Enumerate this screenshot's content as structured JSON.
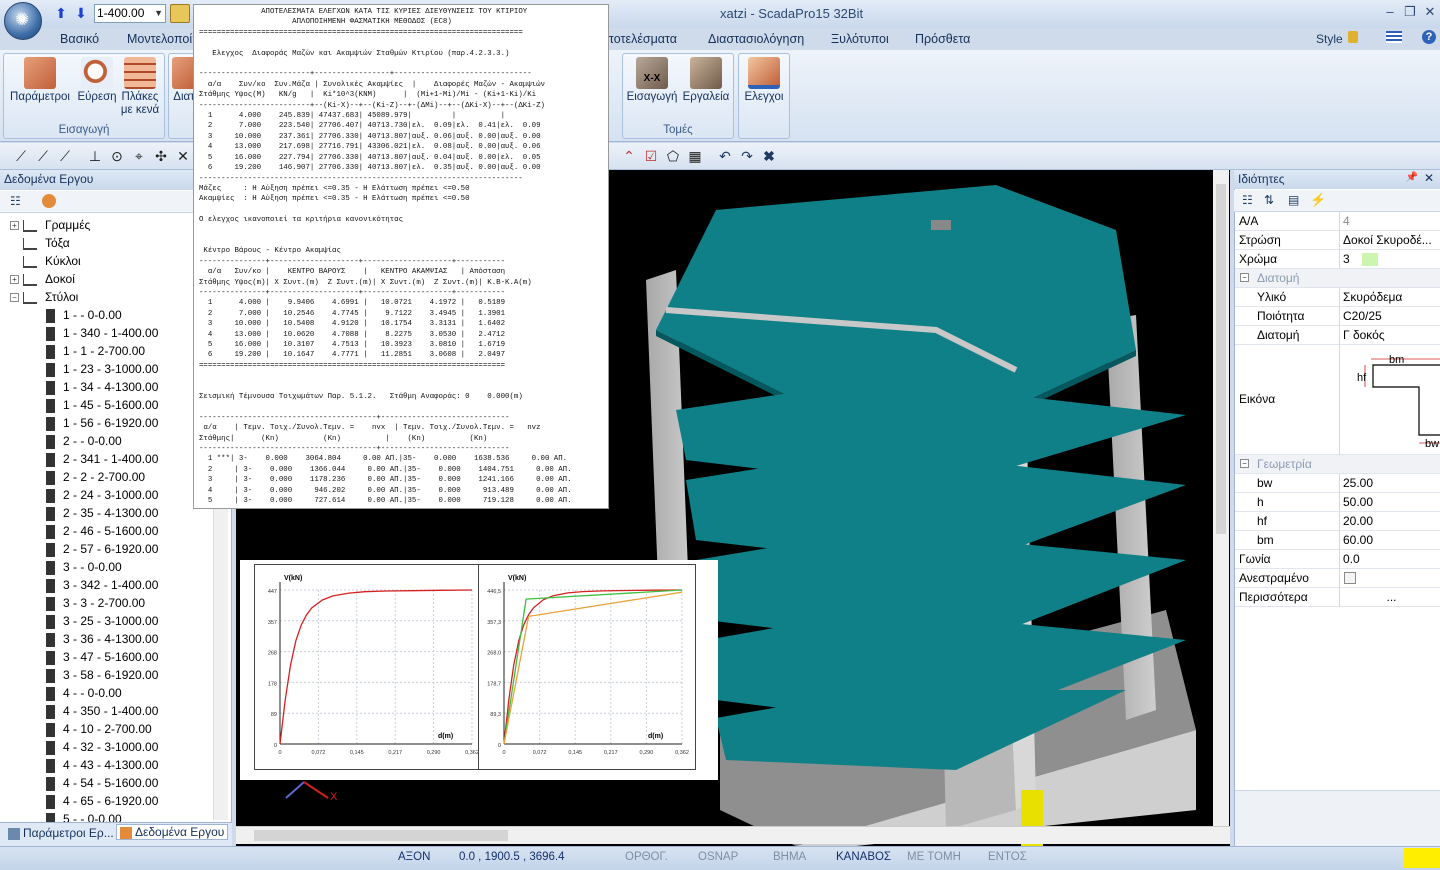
{
  "quick": {
    "level_value": "1-400.00"
  },
  "window": {
    "title": "xatzi - ScadaPro15 32Bit",
    "style_label": "Style",
    "help": "?"
  },
  "tabs": [
    "Βασικό",
    "Μοντελοποίη",
    "Αποτελέσματα",
    "Διαστασιολόγηση",
    "Ξυλότυποι",
    "Πρόσθετα"
  ],
  "ribbon": {
    "insert_group": {
      "label": "Εισαγωγή",
      "buttons": [
        "Παράμετροι",
        "Εύρεση",
        "Πλάκες\nμε κενά"
      ],
      "cut_label": "Διατ"
    },
    "sections_group": {
      "label": "Τομές",
      "buttons": [
        "Εισαγωγή",
        "Εργαλεία"
      ]
    },
    "checks_button": "Ελεγχοι",
    "xx_text": "X-X"
  },
  "left_panel": {
    "title": "Δεδομένα Εργου",
    "tree": [
      {
        "label": "Γραμμές",
        "level": 0,
        "exp": "+"
      },
      {
        "label": "Τόξα",
        "level": 0,
        "exp": ""
      },
      {
        "label": "Κύκλοι",
        "level": 0,
        "exp": ""
      },
      {
        "label": "Δοκοί",
        "level": 0,
        "exp": "+"
      },
      {
        "label": "Στύλοι",
        "level": 0,
        "exp": "−"
      },
      {
        "label": "1 -   - 0-0.00",
        "level": 1
      },
      {
        "label": "1 - 340 - 1-400.00",
        "level": 1
      },
      {
        "label": "1 - 1 - 2-700.00",
        "level": 1
      },
      {
        "label": "1 - 23 - 3-1000.00",
        "level": 1
      },
      {
        "label": "1 - 34 - 4-1300.00",
        "level": 1
      },
      {
        "label": "1 - 45 - 5-1600.00",
        "level": 1
      },
      {
        "label": "1 - 56 - 6-1920.00",
        "level": 1
      },
      {
        "label": "2 -   - 0-0.00",
        "level": 1
      },
      {
        "label": "2 - 341 - 1-400.00",
        "level": 1
      },
      {
        "label": "2 - 2 - 2-700.00",
        "level": 1
      },
      {
        "label": "2 - 24 - 3-1000.00",
        "level": 1
      },
      {
        "label": "2 - 35 - 4-1300.00",
        "level": 1
      },
      {
        "label": "2 - 46 - 5-1600.00",
        "level": 1
      },
      {
        "label": "2 - 57 - 6-1920.00",
        "level": 1
      },
      {
        "label": "3 -   - 0-0.00",
        "level": 1
      },
      {
        "label": "3 - 342 - 1-400.00",
        "level": 1
      },
      {
        "label": "3 - 3 - 2-700.00",
        "level": 1
      },
      {
        "label": "3 - 25 - 3-1000.00",
        "level": 1
      },
      {
        "label": "3 - 36 - 4-1300.00",
        "level": 1
      },
      {
        "label": "3 - 47 - 5-1600.00",
        "level": 1
      },
      {
        "label": "3 - 58 - 6-1920.00",
        "level": 1
      },
      {
        "label": "4 -   - 0-0.00",
        "level": 1
      },
      {
        "label": "4 - 350 - 1-400.00",
        "level": 1
      },
      {
        "label": "4 - 10 - 2-700.00",
        "level": 1
      },
      {
        "label": "4 - 32 - 3-1000.00",
        "level": 1
      },
      {
        "label": "4 - 43 - 4-1300.00",
        "level": 1
      },
      {
        "label": "4 - 54 - 5-1600.00",
        "level": 1
      },
      {
        "label": "4 - 65 - 6-1920.00",
        "level": 1
      },
      {
        "label": "5 -   - 0-0.00",
        "level": 1
      }
    ],
    "bottom_tabs": [
      "Παράμετροι Ερ...",
      "Δεδομένα Εργου"
    ]
  },
  "report": {
    "text": "              ΑΠΟΤΕΛΕΣΜΑΤΑ ΕΛΕΓΧΩΝ ΚΑΤΑ ΤΙΣ ΚΥΡΙΕΣ ΔΙΕΥΘΥΝΣΕΙΣ ΤΟΥ ΚΤΙΡΙΟΥ\n                     ΑΠΛΟΠΟΙΗΜΕΝΗ ΦΑΣΜΑΤΙΚΗ ΜΕΘΟΔΟΣ (ΕC8)\n=========================================================================\n\n   Ελεγχος  Διαφοράς Μαζών και Ακαμψιών Σταθμών Κτιρίου (παρ.4.2.3.3.)\n\n-------------------------+-----------------+-------------------------------\n  α/α    Συν/κο  Συν.Μάζα | Συνολικές Ακαμψίες  |    Διαφορές Μαζών - Ακαμψιών\nΣτάθμης Υψος(M)   KN/g   |  Ki*10^3(KNM)      |  (Mi+1-Mi)/Mi - (Ki+1-Ki)/Ki\n-------------------------+--(Ki-X)--+--(Ki-Z)--+-(ΔMi)--+--(ΔKi-X)--+--(ΔKi-Z)\n  1      4.000    245.839| 47437.683| 45089.979|         |          |\n  2      7.000    223.540| 27706.407| 40713.730|ελ.  0.09|ελ.  0.41|ελ.  0.09\n  3     10.000    237.361| 27706.330| 40713.807|αυξ. 0.06|αυξ. 0.00|αυξ. 0.00\n  4     13.000    217.698| 27716.791| 43306.021|ελ.  0.08|αυξ. 0.00|αυξ. 0.06\n  5     16.000    227.794| 27706.330| 40713.807|αυξ. 0.04|αυξ. 0.00|ελ.  0.05\n  6     19.200    146.907| 27706.330| 40713.807|ελ.  0.35|αυξ. 0.00|αυξ. 0.00\n-------------------------------------------------------------------------\nΜάζες     : Η Αύξηση πρέπει <=0.35 - Η Ελάττωση πρέπει <=0.50\nΑκαμψίες  : Η Αύξηση πρέπει <=0.35 - Η Ελάττωση πρέπει <=0.50\n\nΟ ελεγχος ικανοποιεί τα κριτήρια κανονικότητας\n\n\n Κέντρο Βάρους - Κέντρο Ακαμψίας\n---------------+--------------------+--------------------+-----------\n  α/α   Συν/κο |    ΚΕΝΤΡΟ ΒΑΡΟΥΣ    |   ΚΕΝΤΡΟ ΑΚΑΜΨΙΑΣ   | Απόσταση\nΣτάθμης Υψος(m)| X Συντ.(m)  Z Συντ.(m)| X Συντ.(m)  Z Συντ.(m)| Κ.Β-Κ.Α(m)\n---------------+--------------------+--------------------+-----------\n  1      4.000 |    9.9406    4.6991 |   10.0721    4.1972 |   0.5189\n  2      7.000 |   10.2546    4.7745 |    9.7122    3.4945 |   1.3901\n  3     10.000 |   10.5408    4.9120 |   10.1754    3.3131 |   1.6402\n  4     13.000 |   10.0620    4.7088 |    8.2275    3.0530 |   2.4712\n  5     16.000 |   10.3107    4.7513 |   10.3923    3.0810 |   1.6719\n  6     19.200 |   10.1647    4.7771 |   11.2851    3.0608 |   2.0497\n=====================================================================\n\n\nΣεισμική Τέμνουσα Τοιχωμάτων Παρ. 5.1.2.   Στάθμη Αναφοράς: 0    0.000(m)\n\n----------------------------------------+-----------------------------\n α/α    | Τεμν. Τοιχ./Συνολ.Τεμν. =    nvx  | Τεμν. Τοιχ./Συνολ.Τεμν. =   nvz\nΣτάθμης|      (Kn)          (Kn)          |    (Kn)          (Kn)\n----------------------------------------+-----------------------------\n  1 ***| 3-    0.000    3064.804     0.00 ΑΠ.|35-    0.000    1638.536     0.00 ΑΠ.\n  2     | 3-    0.000    1366.044     0.00 ΑΠ.|35-    0.000    1404.751     0.00 ΑΠ.\n  3     | 3-    0.000    1178.236     0.00 ΑΠ.|35-    0.000    1241.166     0.00 ΑΠ.\n  4     | 3-    0.000     946.202     0.00 ΑΠ.|35-    0.000     913.489     0.00 ΑΠ.\n  5     | 3-    0.000     727.614     0.00 ΑΠ.|35-    0.000     719.128     0.00 ΑΠ.\n  6     | 3-    0.000     319.310     0.00 ΑΠ.|35-    0.000     731.996     0.00 ΑΠ.\n======================================================================="
  },
  "chart_data": [
    {
      "type": "line",
      "ylabel": "V(kN)",
      "xlabel": "d(m)",
      "x_ticks": [
        "0",
        "0,072",
        "0,145",
        "0,217",
        "0,290",
        "0,362"
      ],
      "y_ticks": [
        "447",
        "357",
        "268",
        "178",
        "89",
        "0"
      ],
      "xlim": [
        0,
        0.362
      ],
      "ylim": [
        0,
        447
      ],
      "series": [
        {
          "color": "#d62020",
          "x": [
            0,
            0.01,
            0.02,
            0.03,
            0.04,
            0.05,
            0.06,
            0.08,
            0.1,
            0.13,
            0.16,
            0.2,
            0.25,
            0.3,
            0.362
          ],
          "y": [
            0,
            130,
            230,
            300,
            345,
            375,
            395,
            418,
            430,
            438,
            442,
            444,
            445,
            446,
            447
          ]
        }
      ]
    },
    {
      "type": "line",
      "ylabel": "V(kN)",
      "xlabel": "d(m)",
      "x_ticks": [
        "0",
        "0,072",
        "0,145",
        "0,217",
        "0,290",
        "0,362"
      ],
      "y_ticks": [
        "446,5",
        "357,3",
        "268,0",
        "178,7",
        "89,3",
        "0"
      ],
      "xlim": [
        0,
        0.362
      ],
      "ylim": [
        0,
        446.5
      ],
      "series": [
        {
          "color": "#d62020",
          "x": [
            0,
            0.01,
            0.02,
            0.03,
            0.04,
            0.05,
            0.06,
            0.08,
            0.1,
            0.13,
            0.16,
            0.2,
            0.25,
            0.3,
            0.362
          ],
          "y": [
            0,
            130,
            230,
            300,
            345,
            375,
            395,
            418,
            430,
            438,
            442,
            444,
            445,
            446,
            446.5
          ]
        },
        {
          "color": "#3fbf3f",
          "x": [
            0,
            0.045,
            0.362
          ],
          "y": [
            0,
            420,
            446.5
          ]
        },
        {
          "color": "#e9a23b",
          "x": [
            0,
            0.05,
            0.362
          ],
          "y": [
            0,
            370,
            440
          ]
        }
      ]
    }
  ],
  "properties": {
    "title": "Ιδιότητες",
    "rows": [
      {
        "key": "Α/Α",
        "value": "4",
        "grey": true
      },
      {
        "key": "Στρώση",
        "value": "Δοκοί Σκυροδέ..."
      },
      {
        "key": "Χρώμα",
        "value": "3"
      }
    ],
    "cat_section": "Διατομή",
    "section_rows": [
      {
        "key": "Υλικό",
        "value": "Σκυρόδεμα"
      },
      {
        "key": "Ποιότητα",
        "value": "C20/25"
      },
      {
        "key": "Διατομή",
        "value": "Γ δοκός"
      }
    ],
    "image_label": "Εικόνα",
    "image_labels": {
      "bm": "bm",
      "hf": "hf",
      "bw": "bw"
    },
    "cat_geometry": "Γεωμετρία",
    "geometry_rows": [
      {
        "key": "bw",
        "value": "25.00"
      },
      {
        "key": "h",
        "value": "50.00"
      },
      {
        "key": "hf",
        "value": "20.00"
      },
      {
        "key": "bm",
        "value": "60.00"
      }
    ],
    "extra_rows": [
      {
        "key": "Γωνία",
        "value": "0.0"
      },
      {
        "key": "Ανεστραμένο",
        "value": ""
      },
      {
        "key": "Περισσότερα",
        "value": "..."
      }
    ]
  },
  "status": {
    "items": [
      {
        "text": "ΑΞΟΝ",
        "on": true
      },
      {
        "text": "0.0 , 1900.5 , 3696.4",
        "on": true
      },
      {
        "text": "ΟΡΘΟΓ.",
        "on": false
      },
      {
        "text": "OSNAP",
        "on": false
      },
      {
        "text": "ΒΗΜΑ",
        "on": false
      },
      {
        "text": "ΚΑΝΑΒΟΣ",
        "on": true
      },
      {
        "text": "ΜΕ ΤΟΜΗ",
        "on": false
      },
      {
        "text": "ΕΝΤΟΣ",
        "on": false
      }
    ]
  },
  "viewport": {
    "axis_x": "X"
  }
}
